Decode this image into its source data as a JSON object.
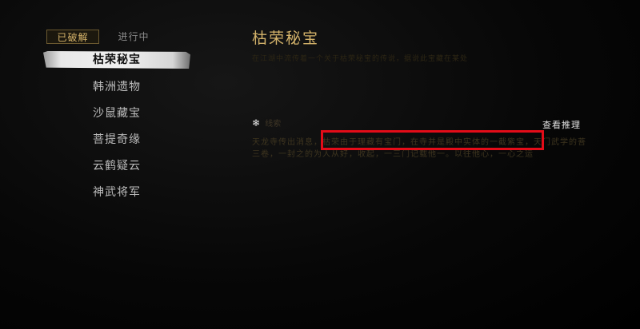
{
  "tabs": {
    "solved": "已破解",
    "in_progress": "进行中"
  },
  "quests": [
    {
      "label": "枯荣秘宝",
      "selected": true
    },
    {
      "label": "韩洲遗物",
      "selected": false
    },
    {
      "label": "沙鼠藏宝",
      "selected": false
    },
    {
      "label": "菩提奇缘",
      "selected": false
    },
    {
      "label": "云鹤疑云",
      "selected": false
    },
    {
      "label": "神武将军",
      "selected": false
    }
  ],
  "detail": {
    "title": "枯荣秘宝",
    "description": "在江湖中流传着一个关于枯荣秘宝的传说，据说此宝藏在某处",
    "clue_label": "线索",
    "view_reasoning": "查看推理",
    "clue_line1": "天龙寺传出消息，枯荣由于理藏有宝门，在寺并是殿中实体的一截紫宝，天门武学的菩",
    "clue_line2": "三卷，一封之的为人从好，收起，一三门记载他一。以往他心，一心之运",
    "highlight": "枯荣由于理藏有宝门在寺并是殿中实体的一截紫宝"
  },
  "colors": {
    "accent_gold": "#d3b26a",
    "highlight_red": "#e30c18"
  },
  "icons": {
    "clue": "snowflake-icon"
  }
}
